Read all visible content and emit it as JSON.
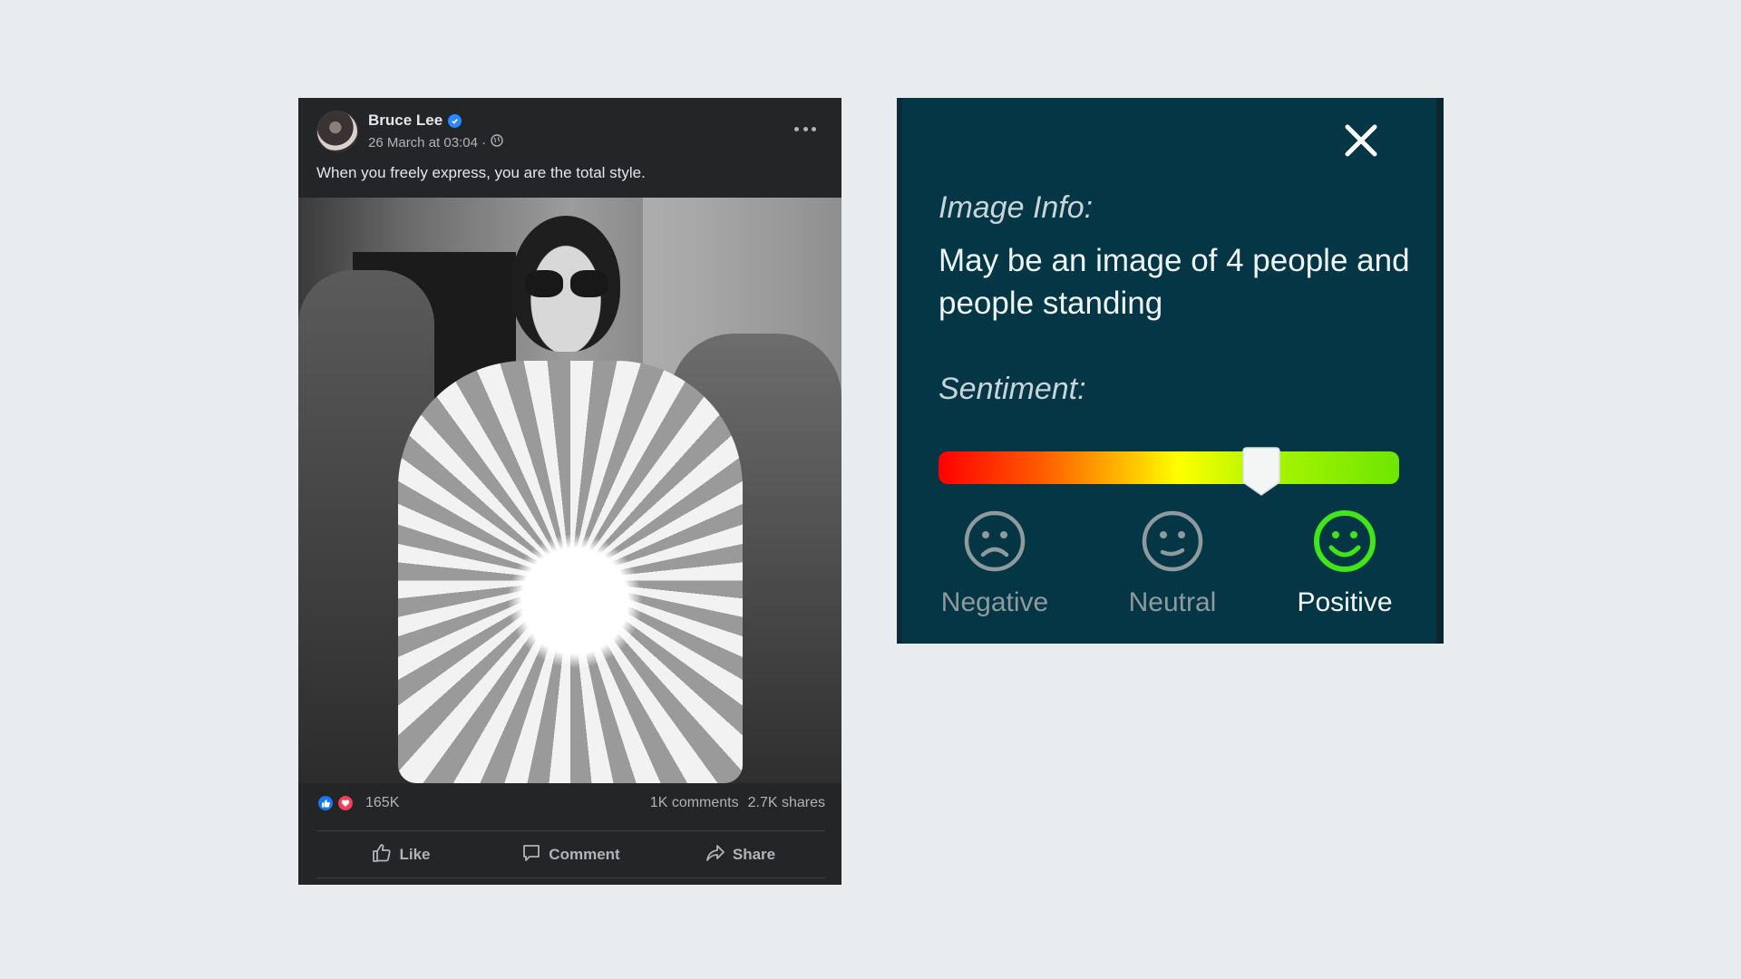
{
  "post": {
    "author": "Bruce Lee",
    "timestamp": "26 March at 03:04 ·",
    "caption": "When you freely express, you are the total style.",
    "reaction_count": "165K",
    "comments": "1K comments",
    "shares": "2.7K shares",
    "actions": {
      "like": "Like",
      "comment": "Comment",
      "share": "Share"
    },
    "icons": [
      "verified-badge-icon",
      "globe-icon",
      "more-options-icon",
      "like-reaction-icon",
      "love-reaction-icon",
      "thumbs-up-icon",
      "comment-icon",
      "share-icon"
    ]
  },
  "panel": {
    "image_info_label": "Image Info:",
    "image_info_text": "May be an image of 4 people and people standing",
    "sentiment_label": "Sentiment:",
    "sentiment_level": 0.7,
    "options": [
      {
        "label": "Negative",
        "face": "frown",
        "color": "#8f9a9d",
        "active": false
      },
      {
        "label": "Neutral",
        "face": "neutral",
        "color": "#8f9a9d",
        "active": false
      },
      {
        "label": "Positive",
        "face": "smile",
        "color": "#3ee61a",
        "active": true
      }
    ]
  },
  "colors": {
    "page_bg": "#e9ecef",
    "post_bg": "#242526",
    "panel_bg": "#053646",
    "accent_blue": "#1877f2",
    "positive_green": "#3ee61a"
  }
}
